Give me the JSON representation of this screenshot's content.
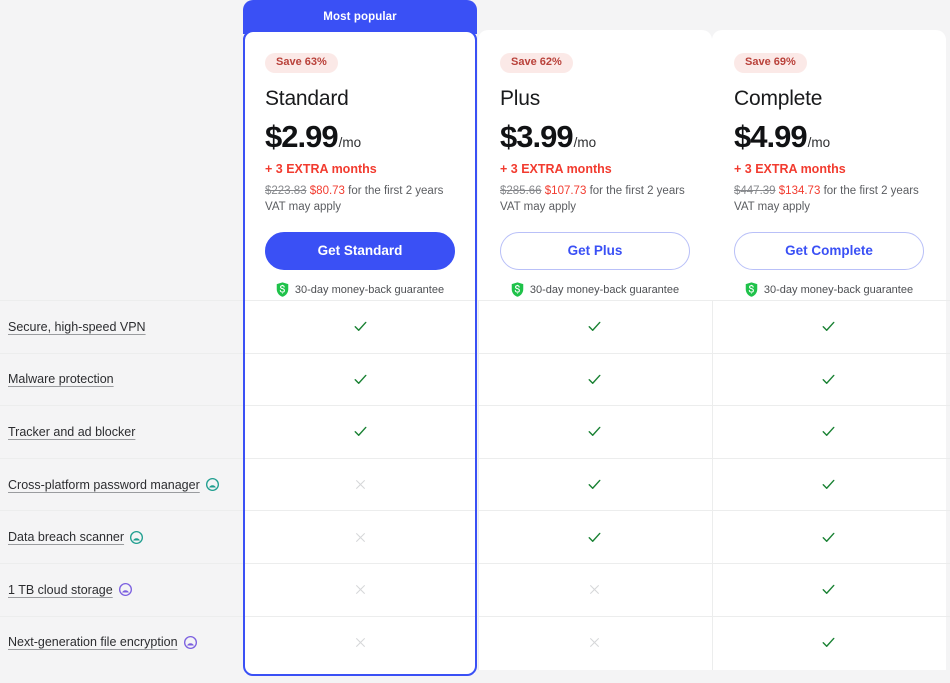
{
  "badge": {
    "most_popular": "Most popular"
  },
  "plans": [
    {
      "id": "standard",
      "save_label": "Save 63%",
      "name": "Standard",
      "price": "$2.99",
      "price_period": "/mo",
      "extra_months": "+ 3 EXTRA months",
      "old_total": "$223.83",
      "new_total": "$80.73",
      "terms_suffix": "for the first 2 years",
      "vat_note": "VAT may apply",
      "cta_label": "Get Standard",
      "guarantee": "30-day money-back guarantee",
      "highlighted": true
    },
    {
      "id": "plus",
      "save_label": "Save 62%",
      "name": "Plus",
      "price": "$3.99",
      "price_period": "/mo",
      "extra_months": "+ 3 EXTRA months",
      "old_total": "$285.66",
      "new_total": "$107.73",
      "terms_suffix": "for the first 2 years",
      "vat_note": "VAT may apply",
      "cta_label": "Get Plus",
      "guarantee": "30-day money-back guarantee",
      "highlighted": false
    },
    {
      "id": "complete",
      "save_label": "Save 69%",
      "name": "Complete",
      "price": "$4.99",
      "price_period": "/mo",
      "extra_months": "+ 3 EXTRA months",
      "old_total": "$447.39",
      "new_total": "$134.73",
      "terms_suffix": "for the first 2 years",
      "vat_note": "VAT may apply",
      "cta_label": "Get Complete",
      "guarantee": "30-day money-back guarantee",
      "highlighted": false
    }
  ],
  "features": [
    {
      "label": "Secure, high-speed VPN",
      "badge_icon": null,
      "standard": "check",
      "plus": "check",
      "complete": "check"
    },
    {
      "label": "Malware protection",
      "badge_icon": null,
      "standard": "check",
      "plus": "check",
      "complete": "check"
    },
    {
      "label": "Tracker and ad blocker",
      "badge_icon": null,
      "standard": "check",
      "plus": "check",
      "complete": "check"
    },
    {
      "label": "Cross-platform password manager",
      "badge_icon": "teal-product-badge-icon",
      "standard": "cross",
      "plus": "check",
      "complete": "check"
    },
    {
      "label": "Data breach scanner",
      "badge_icon": "teal-product-badge-icon",
      "standard": "cross",
      "plus": "check",
      "complete": "check"
    },
    {
      "label": "1 TB cloud storage",
      "badge_icon": "purple-product-badge-icon",
      "standard": "cross",
      "plus": "cross",
      "complete": "check"
    },
    {
      "label": "Next-generation file encryption",
      "badge_icon": "purple-product-badge-icon",
      "standard": "cross",
      "plus": "cross",
      "complete": "check"
    }
  ],
  "colors": {
    "accent": "#3a50f5",
    "sale_red": "#f23b2f",
    "badge_bg": "#fbe9e7",
    "badge_text": "#b9413a",
    "check_green": "#1a8234",
    "cross_gray": "#d6d7d9",
    "page_bg": "#f4f4f5",
    "teal_badge": "#1f9e8f",
    "purple_badge": "#7b5fe0"
  }
}
